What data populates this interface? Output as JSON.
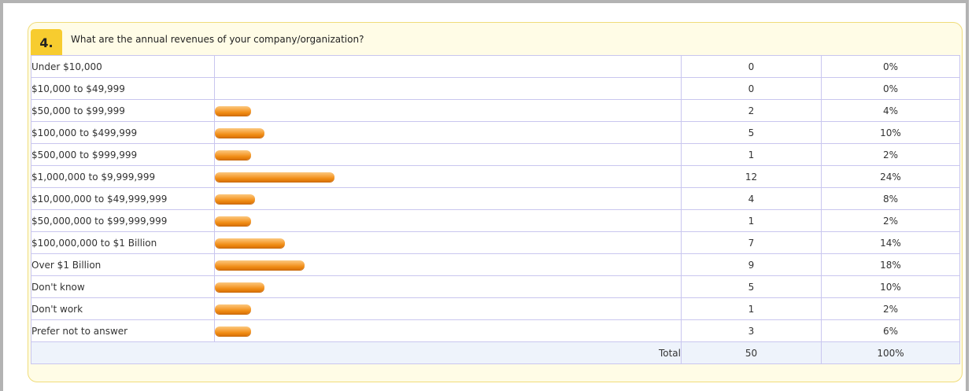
{
  "question": {
    "number": "4.",
    "text": "What are the annual revenues of your company/organization?"
  },
  "chart_data": {
    "type": "bar",
    "orientation": "horizontal",
    "categories": [
      "Under $10,000",
      "$10,000 to $49,999",
      "$50,000 to $99,999",
      "$100,000 to $499,999",
      "$500,000 to $999,999",
      "$1,000,000 to $9,999,999",
      "$10,000,000 to $49,999,999",
      "$50,000,000 to $99,999,999",
      "$100,000,000 to $1 Billion",
      "Over $1 Billion",
      "Don't know",
      "Don't work",
      "Prefer not to answer"
    ],
    "values": [
      0,
      0,
      2,
      5,
      1,
      12,
      4,
      1,
      7,
      9,
      5,
      1,
      3
    ],
    "percents": [
      "0%",
      "0%",
      "4%",
      "10%",
      "2%",
      "24%",
      "8%",
      "2%",
      "14%",
      "18%",
      "10%",
      "2%",
      "6%"
    ],
    "bar_color": "#f39a2c"
  },
  "total": {
    "label": "Total",
    "count": "50",
    "percent": "100%"
  }
}
